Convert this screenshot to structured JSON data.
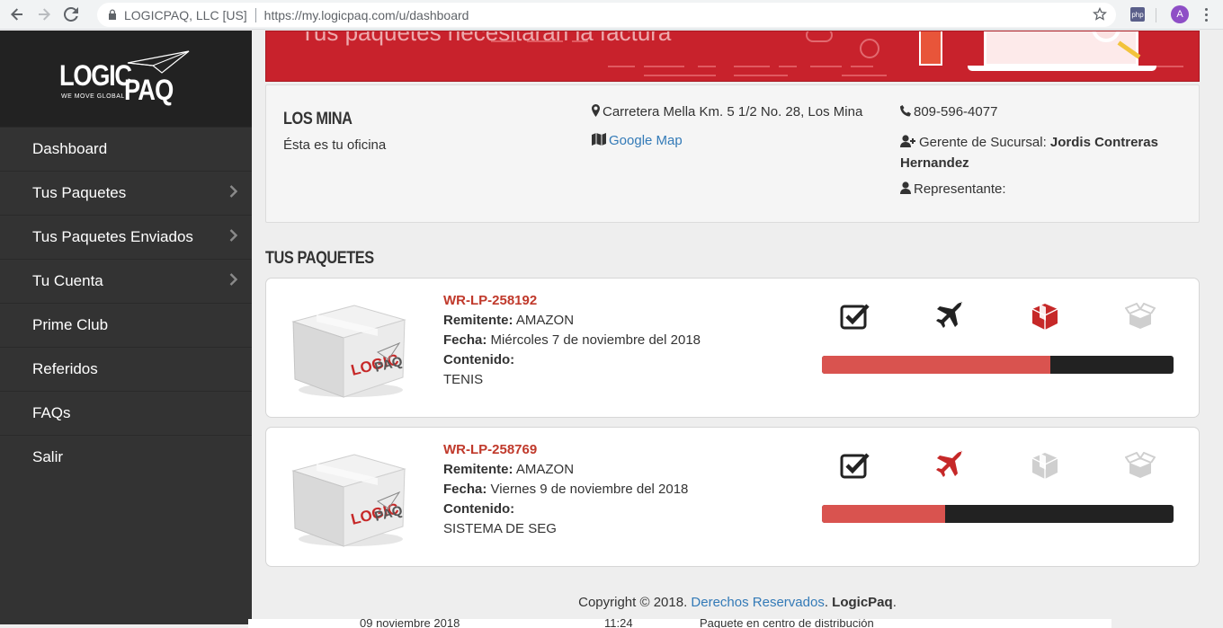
{
  "browser": {
    "site_name": "LOGICPAQ, LLC [US]",
    "url": "https://my.logicpaq.com/u/dashboard",
    "profile_initial": "A",
    "ext_label": "php"
  },
  "logo": {
    "brand_a": "LOGIC",
    "brand_b": "PAQ",
    "tagline": "WE MOVE GLOBAL"
  },
  "sidebar": {
    "items": [
      {
        "label": "Dashboard",
        "has_submenu": false
      },
      {
        "label": "Tus Paquetes",
        "has_submenu": true
      },
      {
        "label": "Tus Paquetes Enviados",
        "has_submenu": true
      },
      {
        "label": "Tu Cuenta",
        "has_submenu": true
      },
      {
        "label": "Prime Club",
        "has_submenu": false
      },
      {
        "label": "Referidos",
        "has_submenu": false
      },
      {
        "label": "FAQs",
        "has_submenu": false
      },
      {
        "label": "Salir",
        "has_submenu": false
      }
    ]
  },
  "banner": {
    "text": "Tus paquetes necesitarán la factura"
  },
  "office": {
    "name": "LOS MINA",
    "subtitle": "Ésta es tu oficina",
    "address": "Carretera Mella Km. 5 1/2 No. 28, Los Mina",
    "map_link": "Google Map",
    "phone": "809-596-4077",
    "manager_label": "Gerente de Sucursal:",
    "manager_name": "Jordis Contreras Hernandez",
    "rep_label": "Representante:"
  },
  "packages_title": "TUS PAQUETES",
  "packages": [
    {
      "code": "WR-LP-258192",
      "sender_label": "Remitente:",
      "sender": "AMAZON",
      "date_label": "Fecha:",
      "date": "Miércoles 7 de noviembre del 2018",
      "content_label": "Contenido:",
      "content": "TENIS",
      "progress_fraction": 0.65,
      "steps": [
        "done",
        "done",
        "active",
        "pending"
      ]
    },
    {
      "code": "WR-LP-258769",
      "sender_label": "Remitente:",
      "sender": "AMAZON",
      "date_label": "Fecha:",
      "date": "Viernes 9 de noviembre del 2018",
      "content_label": "Contenido:",
      "content": "SISTEMA DE SEG",
      "progress_fraction": 0.35,
      "steps": [
        "done",
        "active",
        "pending",
        "pending"
      ]
    }
  ],
  "footer": {
    "copyright": "Copyright © 2018.",
    "rights_link": "Derechos Reservados",
    "brand": "LogicPaq",
    "period": "."
  },
  "underlay_row": {
    "date": "09 noviembre 2018",
    "time": "11:24",
    "status": "Paquete en centro de distribución"
  },
  "colors": {
    "accent": "#d9534f",
    "sidebar": "#333333",
    "link": "#337ab7",
    "code": "#c0392b"
  }
}
